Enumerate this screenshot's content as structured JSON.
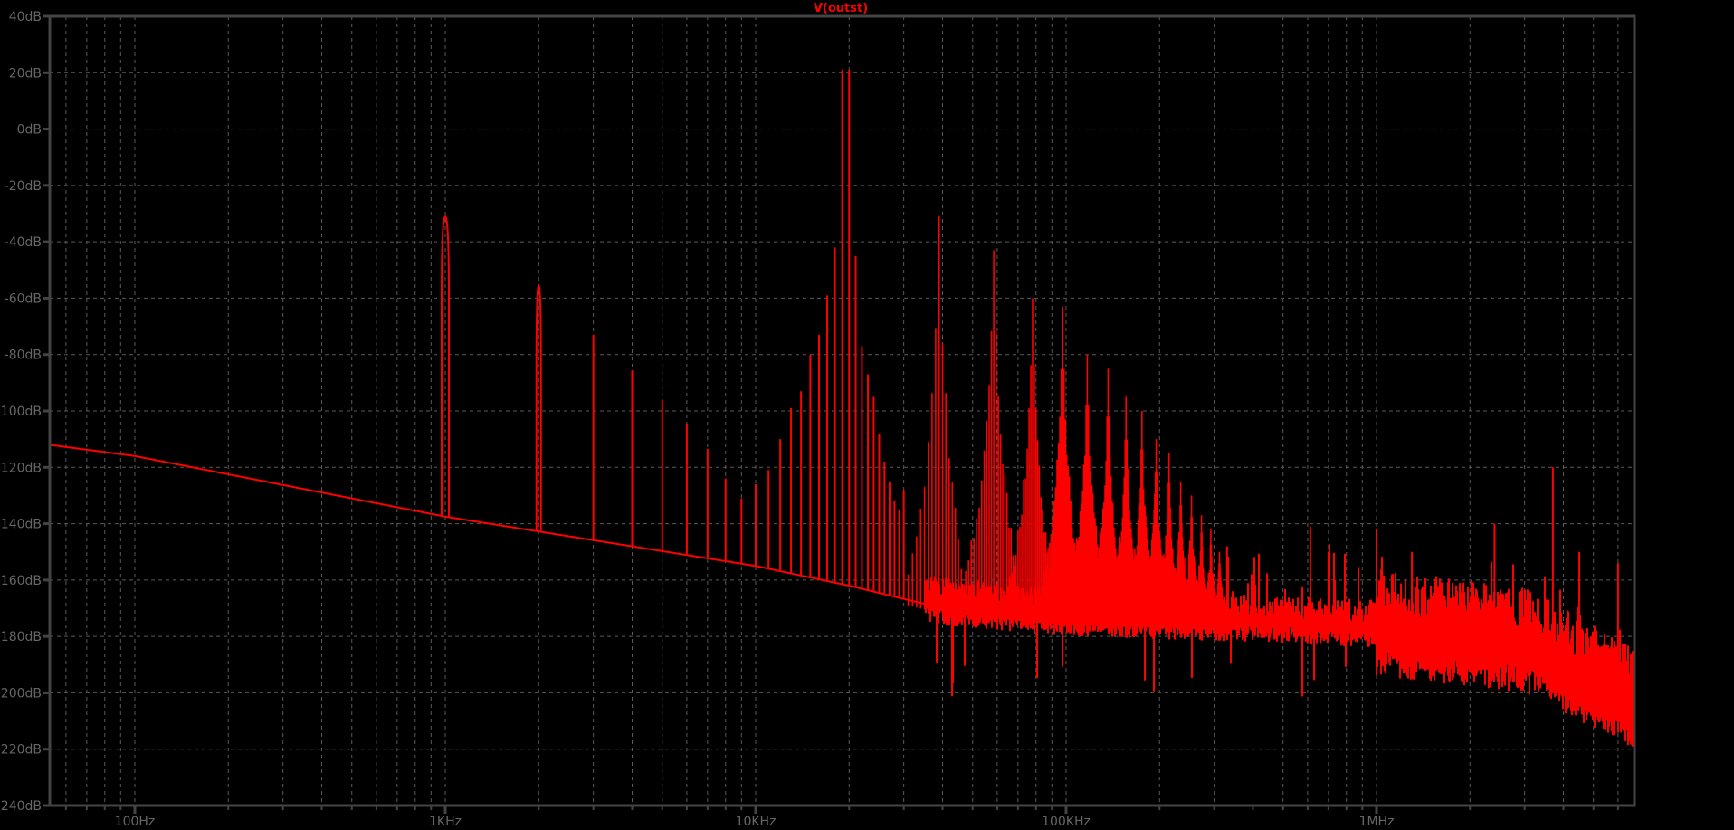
{
  "chart_data": {
    "type": "line",
    "title": "V(outst)",
    "xlabel": "",
    "ylabel": "",
    "x_scale": "log",
    "x_unit": "Hz",
    "y_unit": "dB",
    "xlim": [
      53,
      7000000
    ],
    "ylim": [
      -240,
      40
    ],
    "grid": true,
    "legend": "none",
    "colors": {
      "background": "#000000",
      "trace": "#ff0000",
      "axis": "#444444",
      "grid": "#5a5a5a",
      "tick_label": "#666666"
    },
    "x_ticks": [
      {
        "value": 100,
        "label": "100Hz"
      },
      {
        "value": 1000,
        "label": "1KHz"
      },
      {
        "value": 10000,
        "label": "10KHz"
      },
      {
        "value": 100000,
        "label": "100KHz"
      },
      {
        "value": 1000000,
        "label": "1MHz"
      }
    ],
    "y_ticks": [
      {
        "value": 40,
        "label": "40dB"
      },
      {
        "value": 20,
        "label": "20dB"
      },
      {
        "value": 0,
        "label": "0dB"
      },
      {
        "value": -20,
        "label": "-20dB"
      },
      {
        "value": -40,
        "label": "-40dB"
      },
      {
        "value": -60,
        "label": "-60dB"
      },
      {
        "value": -80,
        "label": "-80dB"
      },
      {
        "value": -100,
        "label": "-100dB"
      },
      {
        "value": -120,
        "label": "-120dB"
      },
      {
        "value": -140,
        "label": "-140dB"
      },
      {
        "value": -160,
        "label": "-160dB"
      },
      {
        "value": -180,
        "label": "-180dB"
      },
      {
        "value": -200,
        "label": "-200dB"
      },
      {
        "value": -220,
        "label": "-220dB"
      },
      {
        "value": -240,
        "label": "-240dB"
      }
    ],
    "noise_floor": [
      [
        53,
        -112
      ],
      [
        100,
        -116
      ],
      [
        1000,
        -137.5
      ],
      [
        10000,
        -155
      ],
      [
        20000,
        -162
      ],
      [
        40000,
        -170
      ],
      [
        100000,
        -174
      ],
      [
        400000,
        -176
      ],
      [
        1000000,
        -178
      ],
      [
        3000000,
        -184
      ],
      [
        7000000,
        -205
      ]
    ],
    "lines_1k_to_30k_hz_step": 1000,
    "lines_1k_to_30k_db": [
      -31,
      -55.5,
      -73,
      -85.6,
      -96,
      -104.5,
      -113.5,
      -124,
      -131,
      -126,
      -121,
      -110,
      -99,
      -93,
      -80,
      -73,
      -59,
      -42,
      21,
      21,
      -45,
      -77,
      -87,
      -95,
      -108,
      -118,
      -125,
      -132,
      -135,
      -128
    ],
    "sideband_clusters": [
      {
        "center_hz": 39000,
        "peak_db": -31,
        "halfwidth_hz": 9000
      },
      {
        "center_hz": 58500,
        "peak_db": -43,
        "halfwidth_hz": 14000
      },
      {
        "center_hz": 78000,
        "peak_db": -60,
        "halfwidth_hz": 16000
      },
      {
        "center_hz": 97500,
        "peak_db": -63,
        "halfwidth_hz": 18000
      },
      {
        "center_hz": 117000,
        "peak_db": -80,
        "halfwidth_hz": 20000
      },
      {
        "center_hz": 136500,
        "peak_db": -85,
        "halfwidth_hz": 20000
      },
      {
        "center_hz": 156000,
        "peak_db": -95,
        "halfwidth_hz": 20000
      },
      {
        "center_hz": 175500,
        "peak_db": -100,
        "halfwidth_hz": 22000
      },
      {
        "center_hz": 195000,
        "peak_db": -110,
        "halfwidth_hz": 24000
      },
      {
        "center_hz": 214500,
        "peak_db": -115,
        "halfwidth_hz": 24000
      },
      {
        "center_hz": 234000,
        "peak_db": -125,
        "halfwidth_hz": 26000
      },
      {
        "center_hz": 253500,
        "peak_db": -130,
        "halfwidth_hz": 26000
      },
      {
        "center_hz": 273000,
        "peak_db": -137,
        "halfwidth_hz": 28000
      },
      {
        "center_hz": 292500,
        "peak_db": -142,
        "halfwidth_hz": 28000
      },
      {
        "center_hz": 312000,
        "peak_db": -150,
        "halfwidth_hz": 30000
      }
    ],
    "hf_spikes": [
      [
        250000,
        -150
      ],
      [
        330000,
        -148
      ],
      [
        612000,
        -141
      ],
      [
        700000,
        -150
      ],
      [
        1000000,
        -142
      ],
      [
        1300000,
        -150
      ],
      [
        2400000,
        -140
      ],
      [
        3700000,
        -120
      ],
      [
        4500000,
        -150
      ],
      [
        6000000,
        -154
      ]
    ]
  }
}
